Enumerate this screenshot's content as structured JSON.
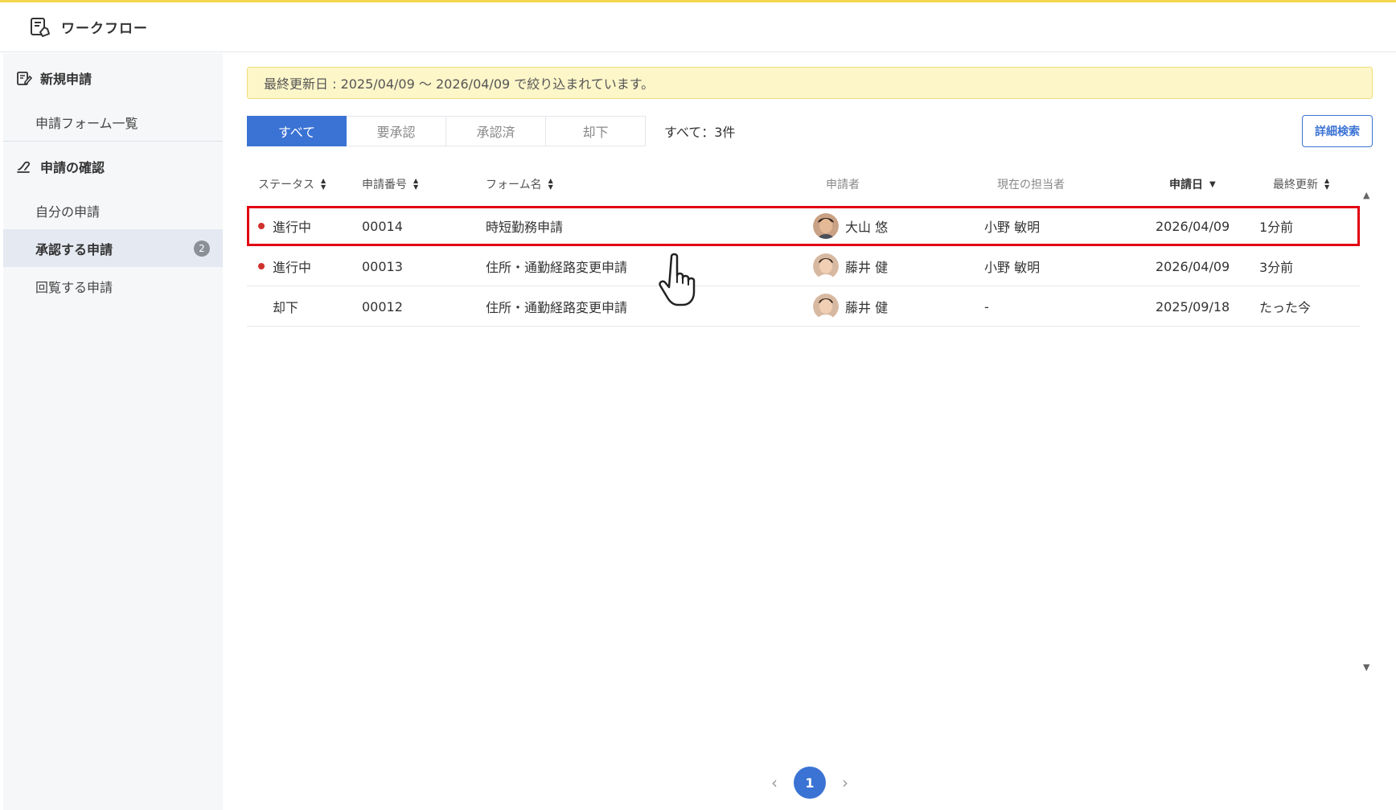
{
  "header": {
    "title": "ワークフロー",
    "logo_icon": "workflow-app-icon"
  },
  "sidebar": {
    "new_section": {
      "label": "新規申請",
      "icon": "edit-document-icon"
    },
    "form_list": "申請フォーム一覧",
    "check_section": {
      "label": "申請の確認",
      "icon": "hand-stamp-icon"
    },
    "my_requests": "自分の申請",
    "to_approve": {
      "label": "承認する申請",
      "badge": "2"
    },
    "circulated": "回覧する申請"
  },
  "filter_banner": "最終更新日 : 2025/04/09 ～ 2026/04/09 で絞り込まれています。",
  "tabs": [
    {
      "label": "すべて",
      "active": true
    },
    {
      "label": "要承認",
      "active": false
    },
    {
      "label": "承認済",
      "active": false
    },
    {
      "label": "却下",
      "active": false
    }
  ],
  "count_label": "すべて：3件",
  "advanced_search_label": "詳細検索",
  "columns": {
    "status": "ステータス",
    "number": "申請番号",
    "form_name": "フォーム名",
    "applicant": "申請者",
    "assignee": "現在の担当者",
    "date": "申請日",
    "updated": "最終更新"
  },
  "rows": [
    {
      "status": "進行中",
      "in_progress": true,
      "number": "00014",
      "form_name": "時短勤務申請",
      "applicant": "大山 悠",
      "assignee": "小野 敏明",
      "date": "2026/04/09",
      "updated": "1分前"
    },
    {
      "status": "進行中",
      "in_progress": true,
      "number": "00013",
      "form_name": "住所・通勤経路変更申請",
      "applicant": "藤井 健",
      "assignee": "小野 敏明",
      "date": "2026/04/09",
      "updated": "3分前"
    },
    {
      "status": "却下",
      "in_progress": false,
      "number": "00012",
      "form_name": "住所・通勤経路変更申請",
      "applicant": "藤井 健",
      "assignee": "-",
      "date": "2025/09/18",
      "updated": "たった今"
    }
  ],
  "pagination": {
    "prev": "‹",
    "current": "1",
    "next": "›"
  },
  "colors": {
    "accent": "#3b73d4",
    "highlight": "#e00012",
    "status_in_progress": "#d0312d",
    "banner_bg": "#fdf6c9"
  }
}
